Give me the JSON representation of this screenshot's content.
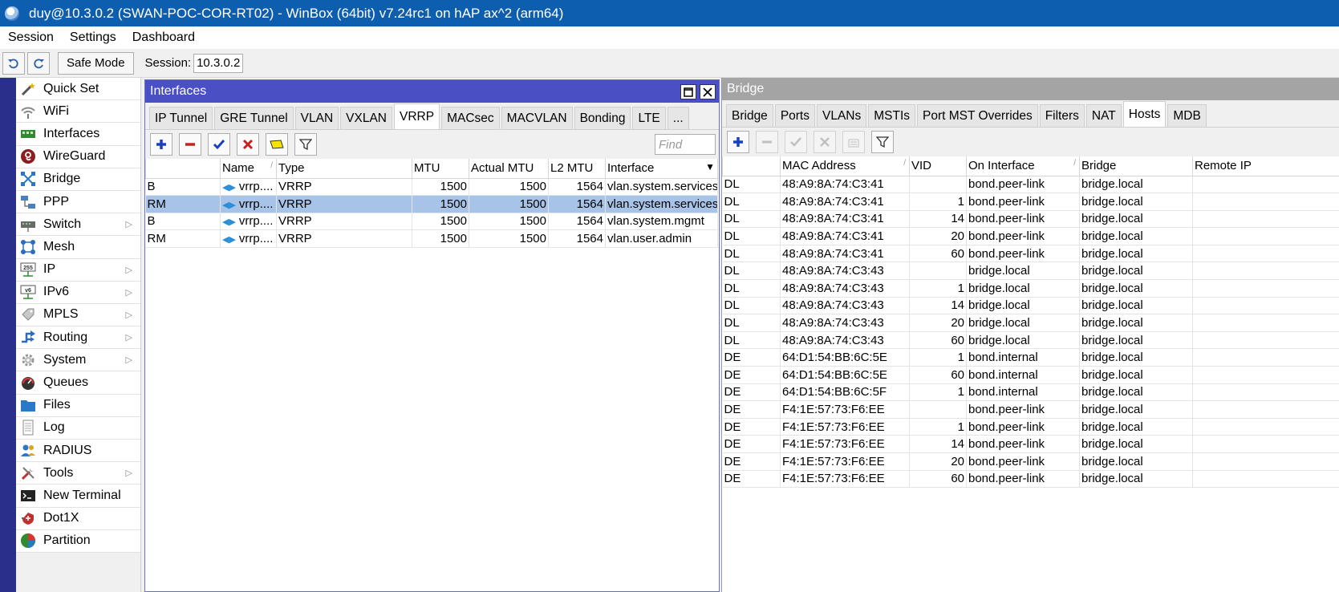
{
  "window_title": "duy@10.3.0.2 (SWAN-POC-COR-RT02) - WinBox (64bit) v7.24rc1 on hAP ax^2 (arm64)",
  "menu": [
    "Session",
    "Settings",
    "Dashboard"
  ],
  "toolbar": {
    "undo_icon": "undo-icon",
    "redo_icon": "redo-icon",
    "safe_mode": "Safe Mode",
    "session_label": "Session:",
    "session_value": "10.3.0.2"
  },
  "sidebar": [
    {
      "label": "Quick Set",
      "icon": "wand-icon",
      "arrow": false
    },
    {
      "label": "WiFi",
      "icon": "wifi-icon",
      "arrow": false
    },
    {
      "label": "Interfaces",
      "icon": "interfaces-icon",
      "arrow": false
    },
    {
      "label": "WireGuard",
      "icon": "wireguard-icon",
      "arrow": false
    },
    {
      "label": "Bridge",
      "icon": "bridge-icon",
      "arrow": false
    },
    {
      "label": "PPP",
      "icon": "ppp-icon",
      "arrow": false
    },
    {
      "label": "Switch",
      "icon": "switch-icon",
      "arrow": true
    },
    {
      "label": "Mesh",
      "icon": "mesh-icon",
      "arrow": false
    },
    {
      "label": "IP",
      "icon": "ip-icon",
      "arrow": true
    },
    {
      "label": "IPv6",
      "icon": "ipv6-icon",
      "arrow": true
    },
    {
      "label": "MPLS",
      "icon": "mpls-icon",
      "arrow": true
    },
    {
      "label": "Routing",
      "icon": "routing-icon",
      "arrow": true
    },
    {
      "label": "System",
      "icon": "gear-icon",
      "arrow": true
    },
    {
      "label": "Queues",
      "icon": "queues-icon",
      "arrow": false
    },
    {
      "label": "Files",
      "icon": "folder-icon",
      "arrow": false
    },
    {
      "label": "Log",
      "icon": "log-icon",
      "arrow": false
    },
    {
      "label": "RADIUS",
      "icon": "radius-icon",
      "arrow": false
    },
    {
      "label": "Tools",
      "icon": "tools-icon",
      "arrow": true
    },
    {
      "label": "New Terminal",
      "icon": "terminal-icon",
      "arrow": false
    },
    {
      "label": "Dot1X",
      "icon": "dot1x-icon",
      "arrow": false
    },
    {
      "label": "Partition",
      "icon": "partition-icon",
      "arrow": false
    }
  ],
  "interfaces": {
    "title": "Interfaces",
    "tabs": [
      "IP Tunnel",
      "GRE Tunnel",
      "VLAN",
      "VXLAN",
      "VRRP",
      "MACsec",
      "MACVLAN",
      "Bonding",
      "LTE",
      "..."
    ],
    "active_tab": "VRRP",
    "find_placeholder": "Find",
    "columns": [
      "",
      "Name",
      "Type",
      "MTU",
      "Actual MTU",
      "L2 MTU",
      "Interface"
    ],
    "rows": [
      {
        "flag": "B",
        "name": "vrrp....",
        "type": "VRRP",
        "mtu": "1500",
        "actual_mtu": "1500",
        "l2_mtu": "1564",
        "interface": "vlan.system.services",
        "selected": false
      },
      {
        "flag": "RM",
        "name": "vrrp....",
        "type": "VRRP",
        "mtu": "1500",
        "actual_mtu": "1500",
        "l2_mtu": "1564",
        "interface": "vlan.system.services",
        "selected": true
      },
      {
        "flag": "B",
        "name": "vrrp....",
        "type": "VRRP",
        "mtu": "1500",
        "actual_mtu": "1500",
        "l2_mtu": "1564",
        "interface": "vlan.system.mgmt",
        "selected": false
      },
      {
        "flag": "RM",
        "name": "vrrp....",
        "type": "VRRP",
        "mtu": "1500",
        "actual_mtu": "1500",
        "l2_mtu": "1564",
        "interface": "vlan.user.admin",
        "selected": false
      }
    ]
  },
  "bridge": {
    "title": "Bridge",
    "tabs": [
      "Bridge",
      "Ports",
      "VLANs",
      "MSTIs",
      "Port MST Overrides",
      "Filters",
      "NAT",
      "Hosts",
      "MDB"
    ],
    "active_tab": "Hosts",
    "columns": [
      "",
      "MAC Address",
      "VID",
      "On Interface",
      "Bridge",
      "Remote IP"
    ],
    "rows": [
      {
        "flag": "DL",
        "mac": "48:A9:8A:74:C3:41",
        "vid": "",
        "on_interface": "bond.peer-link",
        "bridge": "bridge.local"
      },
      {
        "flag": "DL",
        "mac": "48:A9:8A:74:C3:41",
        "vid": "1",
        "on_interface": "bond.peer-link",
        "bridge": "bridge.local"
      },
      {
        "flag": "DL",
        "mac": "48:A9:8A:74:C3:41",
        "vid": "14",
        "on_interface": "bond.peer-link",
        "bridge": "bridge.local"
      },
      {
        "flag": "DL",
        "mac": "48:A9:8A:74:C3:41",
        "vid": "20",
        "on_interface": "bond.peer-link",
        "bridge": "bridge.local"
      },
      {
        "flag": "DL",
        "mac": "48:A9:8A:74:C3:41",
        "vid": "60",
        "on_interface": "bond.peer-link",
        "bridge": "bridge.local"
      },
      {
        "flag": "DL",
        "mac": "48:A9:8A:74:C3:43",
        "vid": "",
        "on_interface": "bridge.local",
        "bridge": "bridge.local"
      },
      {
        "flag": "DL",
        "mac": "48:A9:8A:74:C3:43",
        "vid": "1",
        "on_interface": "bridge.local",
        "bridge": "bridge.local"
      },
      {
        "flag": "DL",
        "mac": "48:A9:8A:74:C3:43",
        "vid": "14",
        "on_interface": "bridge.local",
        "bridge": "bridge.local"
      },
      {
        "flag": "DL",
        "mac": "48:A9:8A:74:C3:43",
        "vid": "20",
        "on_interface": "bridge.local",
        "bridge": "bridge.local"
      },
      {
        "flag": "DL",
        "mac": "48:A9:8A:74:C3:43",
        "vid": "60",
        "on_interface": "bridge.local",
        "bridge": "bridge.local"
      },
      {
        "flag": "DE",
        "mac": "64:D1:54:BB:6C:5E",
        "vid": "1",
        "on_interface": "bond.internal",
        "bridge": "bridge.local"
      },
      {
        "flag": "DE",
        "mac": "64:D1:54:BB:6C:5E",
        "vid": "60",
        "on_interface": "bond.internal",
        "bridge": "bridge.local"
      },
      {
        "flag": "DE",
        "mac": "64:D1:54:BB:6C:5F",
        "vid": "1",
        "on_interface": "bond.internal",
        "bridge": "bridge.local"
      },
      {
        "flag": "DE",
        "mac": "F4:1E:57:73:F6:EE",
        "vid": "",
        "on_interface": "bond.peer-link",
        "bridge": "bridge.local"
      },
      {
        "flag": "DE",
        "mac": "F4:1E:57:73:F6:EE",
        "vid": "1",
        "on_interface": "bond.peer-link",
        "bridge": "bridge.local"
      },
      {
        "flag": "DE",
        "mac": "F4:1E:57:73:F6:EE",
        "vid": "14",
        "on_interface": "bond.peer-link",
        "bridge": "bridge.local"
      },
      {
        "flag": "DE",
        "mac": "F4:1E:57:73:F6:EE",
        "vid": "20",
        "on_interface": "bond.peer-link",
        "bridge": "bridge.local"
      },
      {
        "flag": "DE",
        "mac": "F4:1E:57:73:F6:EE",
        "vid": "60",
        "on_interface": "bond.peer-link",
        "bridge": "bridge.local"
      }
    ]
  },
  "colors": {
    "titlebar": "#0e5eaf",
    "active_window": "#4a4fc4",
    "inactive_window": "#a4a4a4",
    "selection": "#a8c3e8",
    "left_strip": "#2b2f8c"
  }
}
